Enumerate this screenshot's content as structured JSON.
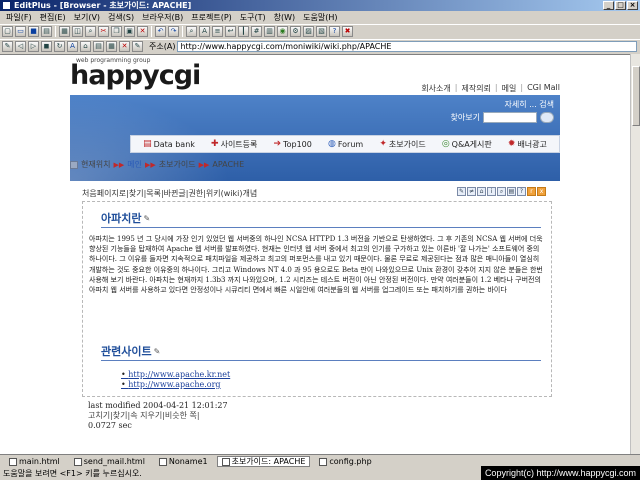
{
  "window": {
    "title": "EditPlus - [Browser - 초보가이드: APACHE]"
  },
  "menu": [
    "파일(F)",
    "편집(E)",
    "보기(V)",
    "검색(S)",
    "브라우저(B)",
    "프로젝트(P)",
    "도구(T)",
    "창(W)",
    "도움말(H)"
  ],
  "address": {
    "label": "주소(A)",
    "url": "http://www.happycgi.com/moniwiki/wiki.php/APACHE"
  },
  "site": {
    "logo_sub": "web programming group",
    "logo": "happycgi",
    "toplinks": [
      "회사소개",
      "제작의뢰",
      "메일",
      "CGI Mall"
    ],
    "banner_tools": "자세히 ... 검색",
    "search_label": "찾아보기",
    "nav": [
      "Data bank",
      "사이트등록",
      "Top100",
      "Forum",
      "초보가이드",
      "Q&A게시판",
      "배너광고"
    ]
  },
  "breadcrumb": {
    "label": "현재위치",
    "home": "메인",
    "section": "초보가이드",
    "page": "APACHE"
  },
  "wiki": {
    "links": "처음페이지로|찾기|목록|바뀐글|권한|위키(wiki)개념",
    "heading1": "아파치란",
    "body": "아파치는 1995 년 그 당시에 가장 인기 있었던 웹 서버중의 하나인 NCSA HTTPD 1.3 버전을 기반으로 탄생하였다. 그 후 기존의 NCSA 웹 서버에 더욱 향상된 기능들을 탑재하여 Apache 웹 서버를 발표하였다. 현재는 인터넷 웹 서버 중에서 최고의 인기를 구가하고 있는 이른바 '잘 나가는' 소프트웨어 중의 하나이다. 그 이유를 들자면 지속적으로 패치파일을 제공하고 최고의 퍼포먼스를 내고 있기 때문이다. 물론 무료로 제공된다는 점과 많은 매니아들이 열심히 개발하는 것도 중요한 이유중의 하나이다. 그리고 Windows NT 4.0 과 95 용으로도 Beta 판이 나와있으므로 Unix 환경이 갖추어 지지 않은 분들은 한번 사용해 보기 바란다. 아파치는 현재까지 1.3b3 까지 나와있으며, 1.2 시리즈는 테스트 버전이 아닌 안정된 버전이다. 만약 여러분들이 1.2 베타나 구버전의 아파치 웹 서버를 사용하고 있다면 안정성이나 시큐리티 면에서 빠른 시일안에 여러분들의 웹 서버를 업그레이드 또는 패치하기를 권하는 바이다",
    "heading2": "관련사이트",
    "related": [
      "http://www.apache.kr.net",
      "http://www.apache.org"
    ],
    "last_modified": "last modified 2004-04-21 12:01:27",
    "actions": "고치기|찾기|속 지우기|비슷한 쪽|",
    "elapsed": "0.0727 sec"
  },
  "tabs": [
    "main.html",
    "send_mail.html",
    "Noname1",
    "초보가이드: APACHE",
    "config.php"
  ],
  "status": "도움말을 보려면 <F1> 키를 누르십시오.",
  "copyright": "Copyright(c) http://www.happycgi.com"
}
